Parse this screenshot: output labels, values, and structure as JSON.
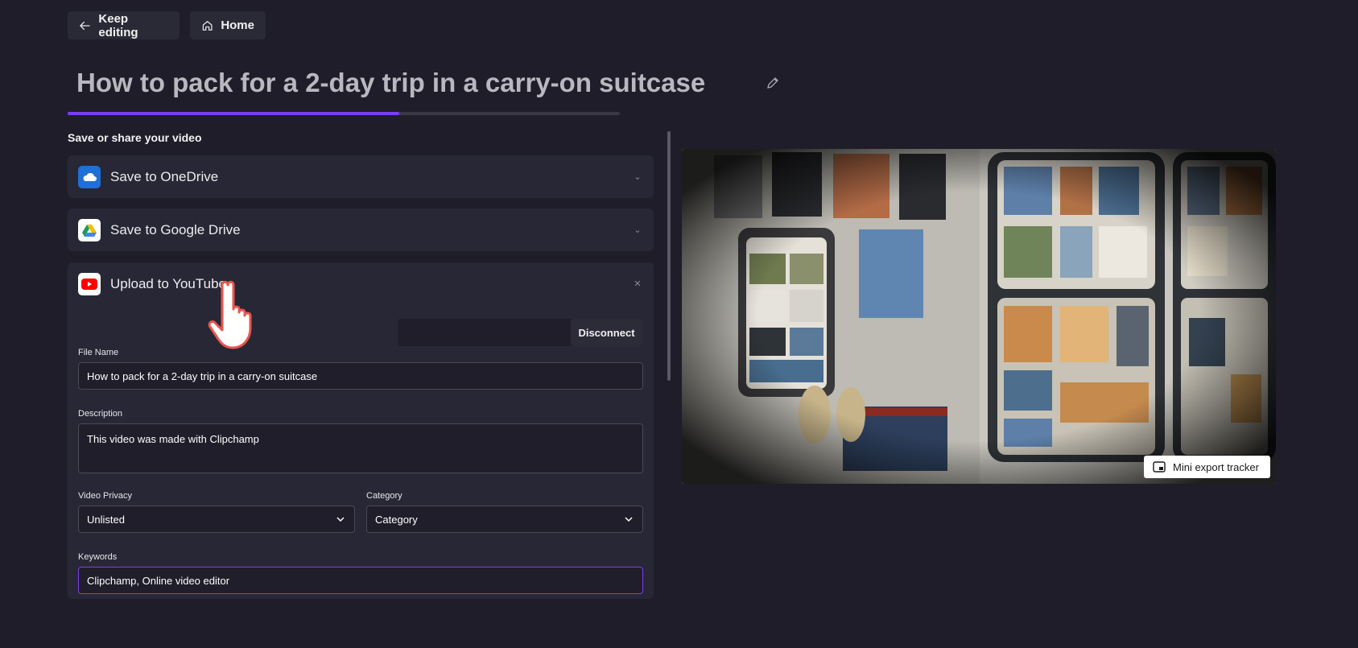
{
  "topbar": {
    "back_label": "Keep editing",
    "home_label": "Home"
  },
  "video": {
    "title": "How to pack for a 2-day trip in a carry-on suitcase",
    "export_progress": 0.6
  },
  "section_heading": "Save or share your video",
  "destinations": [
    {
      "label": "Save to OneDrive",
      "icon": "onedrive-icon",
      "state": "collapsed"
    },
    {
      "label": "Save to Google Drive",
      "icon": "google-drive-icon",
      "state": "collapsed"
    },
    {
      "label": "Upload to YouTube",
      "icon": "youtube-icon",
      "state": "expanded"
    }
  ],
  "youtube_form": {
    "disconnect_label": "Disconnect",
    "file_name_label": "File Name",
    "file_name_value": "How to pack for a 2-day trip in a carry-on suitcase",
    "description_label": "Description",
    "description_value": "This video was made with Clipchamp",
    "privacy_label": "Video Privacy",
    "privacy_value": "Unlisted",
    "category_label": "Category",
    "category_value": "Category",
    "keywords_label": "Keywords",
    "keywords_value": "Clipchamp, Online video editor"
  },
  "preview": {
    "mini_tracker_label": "Mini export tracker"
  },
  "colors": {
    "background": "#1e1d29",
    "panel": "#282735",
    "accent": "#7a3ff0"
  }
}
